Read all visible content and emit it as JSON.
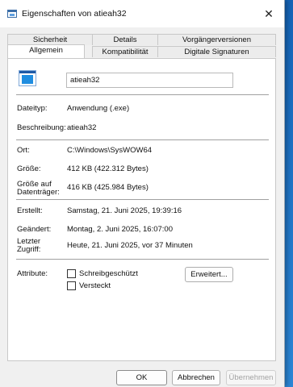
{
  "window": {
    "title": "Eigenschaften von atieah32",
    "close_glyph": "✕"
  },
  "tabs": {
    "row1": [
      "Sicherheit",
      "Details",
      "Vorgängerversionen"
    ],
    "row2": [
      "Allgemein",
      "Kompatibilität",
      "Digitale Signaturen"
    ],
    "active": "Allgemein"
  },
  "general": {
    "file_icon": "application-window-icon",
    "name": "atieah32",
    "dateityp_label": "Dateityp:",
    "dateityp_value": "Anwendung (.exe)",
    "beschreibung_label": "Beschreibung:",
    "beschreibung_value": "atieah32",
    "ort_label": "Ort:",
    "ort_value": "C:\\Windows\\SysWOW64",
    "groesse_label": "Größe:",
    "groesse_value": "412 KB (422.312 Bytes)",
    "groesse_datentraeger_label": "Größe auf Datenträger:",
    "groesse_datentraeger_value": "416 KB (425.984 Bytes)",
    "erstellt_label": "Erstellt:",
    "erstellt_value": "Samstag, 21. Juni 2025, 19:39:16",
    "geaendert_label": "Geändert:",
    "geaendert_value": "Montag, 2. Juni 2025, 16:07:00",
    "zugriff_label": "Letzter Zugriff:",
    "zugriff_value": "Heute, 21. Juni 2025, vor 37 Minuten",
    "attribute_label": "Attribute:",
    "schreibgeschuetzt_label": "Schreibgeschützt",
    "schreibgeschuetzt_checked": false,
    "versteckt_label": "Versteckt",
    "versteckt_checked": false,
    "erweitert_button": "Erweitert..."
  },
  "footer": {
    "ok": "OK",
    "abbrechen": "Abbrechen",
    "uebernehmen": "Übernehmen"
  },
  "colors": {
    "window_bg": "#f0f0f0",
    "panel_bg": "#ffffff",
    "desktop_accent": "#1565b8"
  }
}
